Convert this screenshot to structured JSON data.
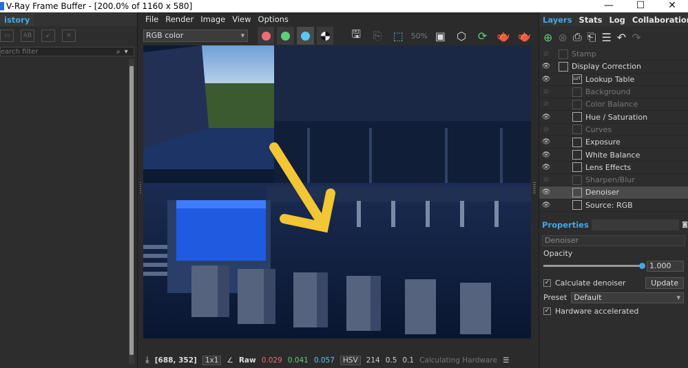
{
  "window": {
    "title": "V-Ray Frame Buffer - [200.0% of 1160 x 580]",
    "controls": [
      "—",
      "☐",
      "✕"
    ]
  },
  "history": {
    "tab": "istory",
    "search_placeholder": "earch filter"
  },
  "menu": [
    "File",
    "Render",
    "Image",
    "View",
    "Options"
  ],
  "toolbar": {
    "channel": "RGB color",
    "colors": {
      "red": "#f06a78",
      "green": "#5fd07a",
      "blue": "#5bc8f2"
    },
    "zoom_badge": "50%"
  },
  "status": {
    "coords": "[688, 352]",
    "ratio": "1x1",
    "mode": "Raw",
    "r": "0.029",
    "g": "0.041",
    "b": "0.057",
    "colorspace": "HSV",
    "h": "214",
    "s": "0.5",
    "v": "0.1",
    "message": "Calculating Hardware"
  },
  "right": {
    "tabs": [
      "Layers",
      "Stats",
      "Log",
      "Collaboration"
    ],
    "layers": [
      {
        "name": "Stamp",
        "visible": false,
        "indent": 0,
        "icon": "stamp"
      },
      {
        "name": "Display Correction",
        "visible": true,
        "indent": 0,
        "icon": "curve"
      },
      {
        "name": "Lookup Table",
        "visible": true,
        "indent": 1,
        "icon": "LUT"
      },
      {
        "name": "Background",
        "visible": false,
        "indent": 1,
        "icon": "bg"
      },
      {
        "name": "Color Balance",
        "visible": false,
        "indent": 1,
        "icon": "cb"
      },
      {
        "name": "Hue / Saturation",
        "visible": true,
        "indent": 1,
        "icon": "hs"
      },
      {
        "name": "Curves",
        "visible": false,
        "indent": 1,
        "icon": "curve"
      },
      {
        "name": "Exposure",
        "visible": true,
        "indent": 1,
        "icon": "exp"
      },
      {
        "name": "White Balance",
        "visible": true,
        "indent": 1,
        "icon": "wb"
      },
      {
        "name": "Lens Effects",
        "visible": true,
        "indent": 1,
        "icon": "lens"
      },
      {
        "name": "Sharpen/Blur",
        "visible": false,
        "indent": 1,
        "icon": "sharp"
      },
      {
        "name": "Denoiser",
        "visible": true,
        "indent": 1,
        "icon": "dn",
        "selected": true
      },
      {
        "name": "Source: RGB",
        "visible": true,
        "indent": 1,
        "icon": "rgb"
      }
    ],
    "properties": {
      "title": "Properties",
      "layer_name": "Denoiser",
      "opacity_label": "Opacity",
      "opacity_value": "1.000",
      "calc_label": "Calculate denoiser",
      "update_label": "Update",
      "preset_label": "Preset",
      "preset_value": "Default",
      "hw_label": "Hardware accelerated"
    }
  }
}
